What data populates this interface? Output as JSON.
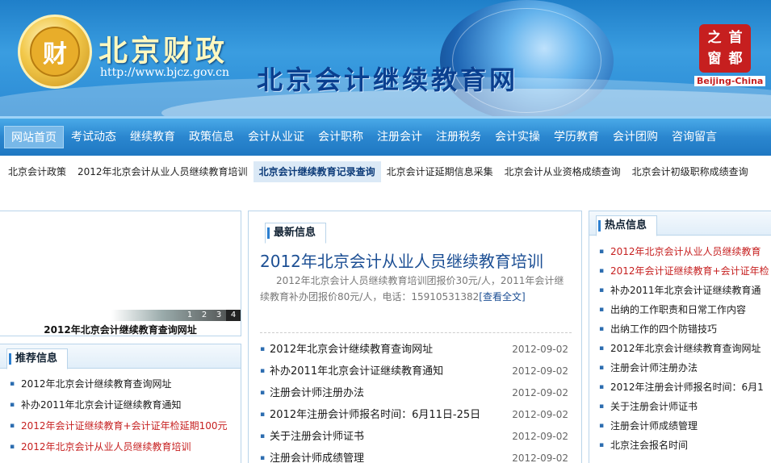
{
  "banner": {
    "logo_char": "财",
    "brand_title": "北京财政",
    "brand_url": "http://www.bjcz.gov.cn",
    "site_title": "北京会计继续教育网",
    "seal_chars": [
      "首",
      "之",
      "都",
      "窗"
    ],
    "seal_en": "Beijing-China"
  },
  "main_nav": [
    {
      "label": "网站首页",
      "active": true
    },
    {
      "label": "考试动态"
    },
    {
      "label": "继续教育"
    },
    {
      "label": "政策信息"
    },
    {
      "label": "会计从业证"
    },
    {
      "label": "会计职称"
    },
    {
      "label": "注册会计"
    },
    {
      "label": "注册税务"
    },
    {
      "label": "会计实操"
    },
    {
      "label": "学历教育"
    },
    {
      "label": "会计团购"
    },
    {
      "label": "咨询留言"
    }
  ],
  "sub_nav": [
    {
      "label": "北京会计政策"
    },
    {
      "label": "2012年北京会计从业人员继续教育培训"
    },
    {
      "label": "北京会计继续教育记录查询",
      "active": true
    },
    {
      "label": "北京会计证延期信息采集"
    },
    {
      "label": "北京会计从业资格成绩查询"
    },
    {
      "label": "北京会计初级职称成绩查询"
    }
  ],
  "slideshow": {
    "pages": [
      "1",
      "2",
      "3",
      "4"
    ],
    "caption": "2012年北京会计继续教育查询网址"
  },
  "recommend": {
    "title": "推荐信息",
    "items": [
      {
        "text": "2012年北京会计继续教育查询网址"
      },
      {
        "text": "补办2011年北京会计证继续教育通知"
      },
      {
        "text": "2012年会计证继续教育+会计证年检延期100元",
        "red": true
      },
      {
        "text": "2012年北京会计从业人员继续教育培训",
        "red": true
      }
    ]
  },
  "latest": {
    "title": "最新信息",
    "headline": "2012年北京会计从业人员继续教育培训",
    "summary": "2012年北京会计人员继续教育培训团报价30元/人，2011年会计继续教育补办团报价80元/人，电话：15910531382",
    "read_more": "[查看全文]",
    "items": [
      {
        "text": "2012年北京会计继续教育查询网址",
        "date": "2012-09-02"
      },
      {
        "text": "补办2011年北京会计证继续教育通知",
        "date": "2012-09-02"
      },
      {
        "text": "注册会计师注册办法",
        "date": "2012-09-02"
      },
      {
        "text": "2012年注册会计师报名时间：6月11日-25日",
        "date": "2012-09-02"
      },
      {
        "text": "关于注册会计师证书",
        "date": "2012-09-02"
      },
      {
        "text": "注册会计师成绩管理",
        "date": "2012-09-02"
      }
    ]
  },
  "hot": {
    "title": "热点信息",
    "items": [
      {
        "text": "2012年北京会计从业人员继续教育",
        "red": true
      },
      {
        "text": "2012年会计证继续教育+会计证年检",
        "red": true,
        "wrap": true
      },
      {
        "text": "补办2011年北京会计证继续教育通"
      },
      {
        "text": "出纳的工作职责和日常工作内容"
      },
      {
        "text": "出纳工作的四个防错技巧"
      },
      {
        "text": "2012年北京会计继续教育查询网址"
      },
      {
        "text": "注册会计师注册办法"
      },
      {
        "text": "2012年注册会计师报名时间：6月1"
      },
      {
        "text": "关于注册会计师证书"
      },
      {
        "text": "注册会计师成绩管理"
      },
      {
        "text": "北京注会报名时间"
      }
    ]
  },
  "colors": {
    "nav_blue": "#2a86cf",
    "link_red": "#c61f1f",
    "headline_blue": "#1c4f94"
  }
}
